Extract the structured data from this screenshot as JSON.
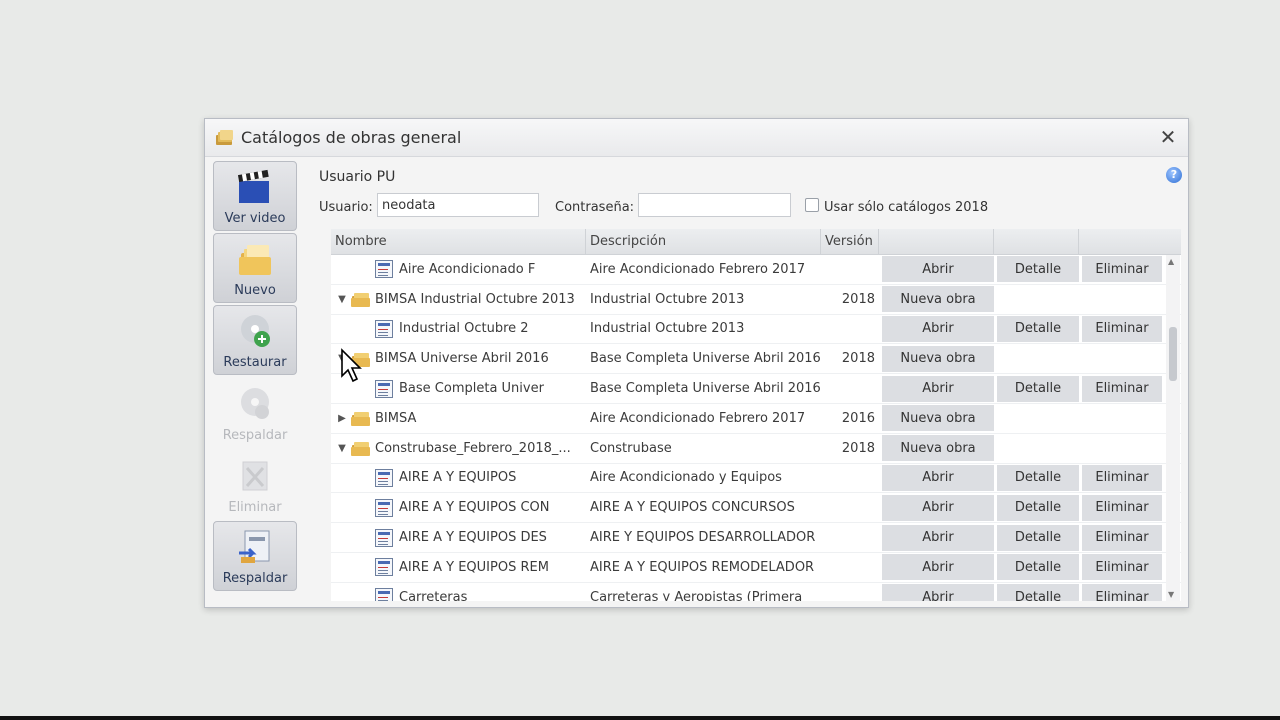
{
  "window": {
    "title": "Catálogos de obras general",
    "close_label": "✕"
  },
  "toolbar": {
    "buttons": [
      {
        "label": "Ver video",
        "icon": "video-clapper-icon",
        "enabled": true
      },
      {
        "label": "Nuevo",
        "icon": "new-folder-icon",
        "enabled": true
      },
      {
        "label": "Restaurar",
        "icon": "restore-disc-icon",
        "enabled": true
      },
      {
        "label": "Respaldar",
        "icon": "backup-disc-icon",
        "enabled": false
      },
      {
        "label": "Eliminar",
        "icon": "delete-icon",
        "enabled": false
      },
      {
        "label": "Respaldar",
        "icon": "backup-file-icon",
        "enabled": true
      }
    ]
  },
  "panel": {
    "user_title": "Usuario PU",
    "usuario_label": "Usuario:",
    "usuario_value": "neodata",
    "password_label": "Contraseña:",
    "password_value": "",
    "checkbox_label": "Usar sólo catálogos 2018",
    "checkbox_checked": false,
    "help": "?"
  },
  "grid": {
    "headers": {
      "name": "Nombre",
      "desc": "Descripción",
      "version": "Versión"
    },
    "rows": [
      {
        "kind": "doc",
        "level": 1,
        "name": "Aire Acondicionado F",
        "desc": "Aire Acondicionado Febrero 2017",
        "version": "",
        "b1": "Abrir",
        "b2": "Detalle",
        "b3": "Eliminar"
      },
      {
        "kind": "folder",
        "level": 0,
        "exp": "▼",
        "name": "BIMSA Industrial Octubre 2013",
        "desc": "Industrial Octubre 2013",
        "version": "2018",
        "b1": "Nueva obra",
        "b2": "",
        "b3": ""
      },
      {
        "kind": "doc",
        "level": 1,
        "name": "Industrial Octubre 2",
        "desc": "Industrial Octubre 2013",
        "version": "",
        "b1": "Abrir",
        "b2": "Detalle",
        "b3": "Eliminar"
      },
      {
        "kind": "folder",
        "level": 0,
        "exp": "▼",
        "name": "BIMSA Universe Abril 2016",
        "desc": "Base Completa Universe Abril 2016",
        "version": "2018",
        "b1": "Nueva obra",
        "b2": "",
        "b3": ""
      },
      {
        "kind": "doc",
        "level": 1,
        "name": "Base Completa Univer",
        "desc": "Base Completa Universe Abril 2016",
        "version": "",
        "b1": "Abrir",
        "b2": "Detalle",
        "b3": "Eliminar"
      },
      {
        "kind": "folder",
        "level": 0,
        "exp": "▶",
        "name": "BIMSA",
        "desc": "Aire Acondicionado Febrero 2017",
        "version": "2016",
        "b1": "Nueva obra",
        "b2": "",
        "b3": ""
      },
      {
        "kind": "folder",
        "level": 0,
        "exp": "▼",
        "name": "Construbase_Febrero_2018_...",
        "desc": "Construbase",
        "version": "2018",
        "b1": "Nueva obra",
        "b2": "",
        "b3": ""
      },
      {
        "kind": "doc",
        "level": 1,
        "name": "AIRE A Y EQUIPOS",
        "desc": "Aire Acondicionado y Equipos",
        "version": "",
        "b1": "Abrir",
        "b2": "Detalle",
        "b3": "Eliminar"
      },
      {
        "kind": "doc",
        "level": 1,
        "name": "AIRE A Y EQUIPOS CON",
        "desc": "AIRE A Y EQUIPOS CONCURSOS",
        "version": "",
        "b1": "Abrir",
        "b2": "Detalle",
        "b3": "Eliminar"
      },
      {
        "kind": "doc",
        "level": 1,
        "name": "AIRE A Y EQUIPOS DES",
        "desc": "AIRE Y EQUIPOS DESARROLLADOR",
        "version": "",
        "b1": "Abrir",
        "b2": "Detalle",
        "b3": "Eliminar"
      },
      {
        "kind": "doc",
        "level": 1,
        "name": "AIRE A Y EQUIPOS REM",
        "desc": "AIRE A Y EQUIPOS REMODELADOR",
        "version": "",
        "b1": "Abrir",
        "b2": "Detalle",
        "b3": "Eliminar"
      },
      {
        "kind": "doc",
        "level": 1,
        "name": "Carreteras",
        "desc": "Carreteras y Aeropistas (Primera",
        "version": "",
        "b1": "Abrir",
        "b2": "Detalle",
        "b3": "Eliminar"
      }
    ]
  },
  "colors": {
    "accent": "#2f6fd4",
    "button_bg": "#dcdee2"
  }
}
